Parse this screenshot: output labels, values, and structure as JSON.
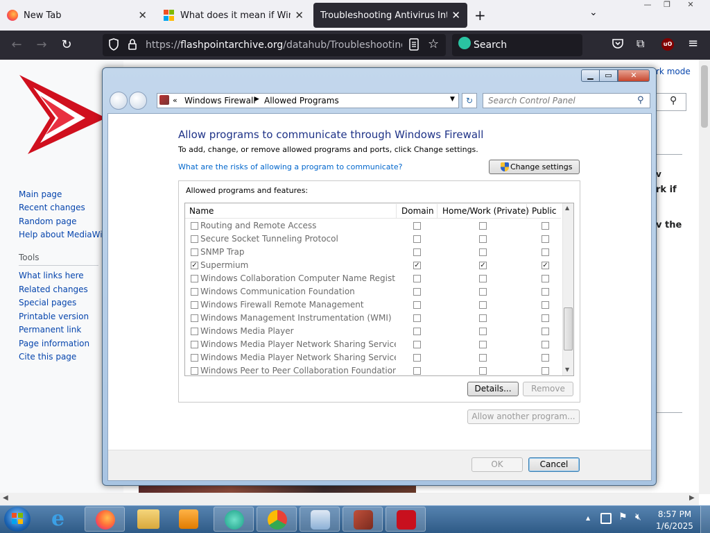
{
  "browser": {
    "tabs": [
      {
        "title": "New Tab",
        "icon": "firefox-icon"
      },
      {
        "title": "What does it mean if Windows",
        "icon": "microsoft-icon"
      },
      {
        "title": "Troubleshooting Antivirus Interfere",
        "icon": "none"
      }
    ],
    "new_tab_symbol": "+",
    "url_prefix": "https://",
    "url_host": "flashpointarchive.org",
    "url_path": "/datahub/Troubleshooting_Antiv",
    "search_placeholder": "Search",
    "profile_badge": "uO"
  },
  "wiki": {
    "nav_links": [
      "Main page",
      "Recent changes",
      "Random page",
      "Help about MediaWiki"
    ],
    "tools_heading": "Tools",
    "tool_links": [
      "What links here",
      "Related changes",
      "Special pages",
      "Printable version",
      "Permanent link",
      "Page information",
      "Cite this page"
    ],
    "right_fragments": [
      "rk mode",
      "v",
      "rk if",
      "v the"
    ]
  },
  "dialog": {
    "breadcrumb_sep": "«",
    "breadcrumb": [
      "Windows Firewall",
      "Allowed Programs"
    ],
    "search_placeholder": "Search Control Panel",
    "heading": "Allow programs to communicate through Windows Firewall",
    "subtext": "To add, change, or remove allowed programs and ports, click Change settings.",
    "risk_link": "What are the risks of allowing a program to communicate?",
    "change_settings_label": "Change settings",
    "group_label": "Allowed programs and features:",
    "columns": [
      "Name",
      "Domain",
      "Home/Work (Private)",
      "Public"
    ],
    "programs": [
      {
        "name": "Routing and Remote Access",
        "enabled": false,
        "domain": false,
        "private": false,
        "public": false
      },
      {
        "name": "Secure Socket Tunneling Protocol",
        "enabled": false,
        "domain": false,
        "private": false,
        "public": false
      },
      {
        "name": "SNMP Trap",
        "enabled": false,
        "domain": false,
        "private": false,
        "public": false
      },
      {
        "name": "Supermium",
        "enabled": true,
        "domain": true,
        "private": true,
        "public": true
      },
      {
        "name": "Windows Collaboration Computer Name Registrati...",
        "enabled": false,
        "domain": false,
        "private": false,
        "public": false
      },
      {
        "name": "Windows Communication Foundation",
        "enabled": false,
        "domain": false,
        "private": false,
        "public": false
      },
      {
        "name": "Windows Firewall Remote Management",
        "enabled": false,
        "domain": false,
        "private": false,
        "public": false
      },
      {
        "name": "Windows Management Instrumentation (WMI)",
        "enabled": false,
        "domain": false,
        "private": false,
        "public": false
      },
      {
        "name": "Windows Media Player",
        "enabled": false,
        "domain": false,
        "private": false,
        "public": false
      },
      {
        "name": "Windows Media Player Network Sharing Service",
        "enabled": false,
        "domain": false,
        "private": false,
        "public": false
      },
      {
        "name": "Windows Media Player Network Sharing Service (In...",
        "enabled": false,
        "domain": false,
        "private": false,
        "public": false
      },
      {
        "name": "Windows Peer to Peer Collaboration Foundation",
        "enabled": false,
        "domain": false,
        "private": false,
        "public": false
      }
    ],
    "details_label": "Details...",
    "remove_label": "Remove",
    "allow_another_label": "Allow another program...",
    "ok_label": "OK",
    "cancel_label": "Cancel"
  },
  "taskbar": {
    "time": "8:57 PM",
    "date": "1/6/2025",
    "tray_arrow": "▲"
  }
}
